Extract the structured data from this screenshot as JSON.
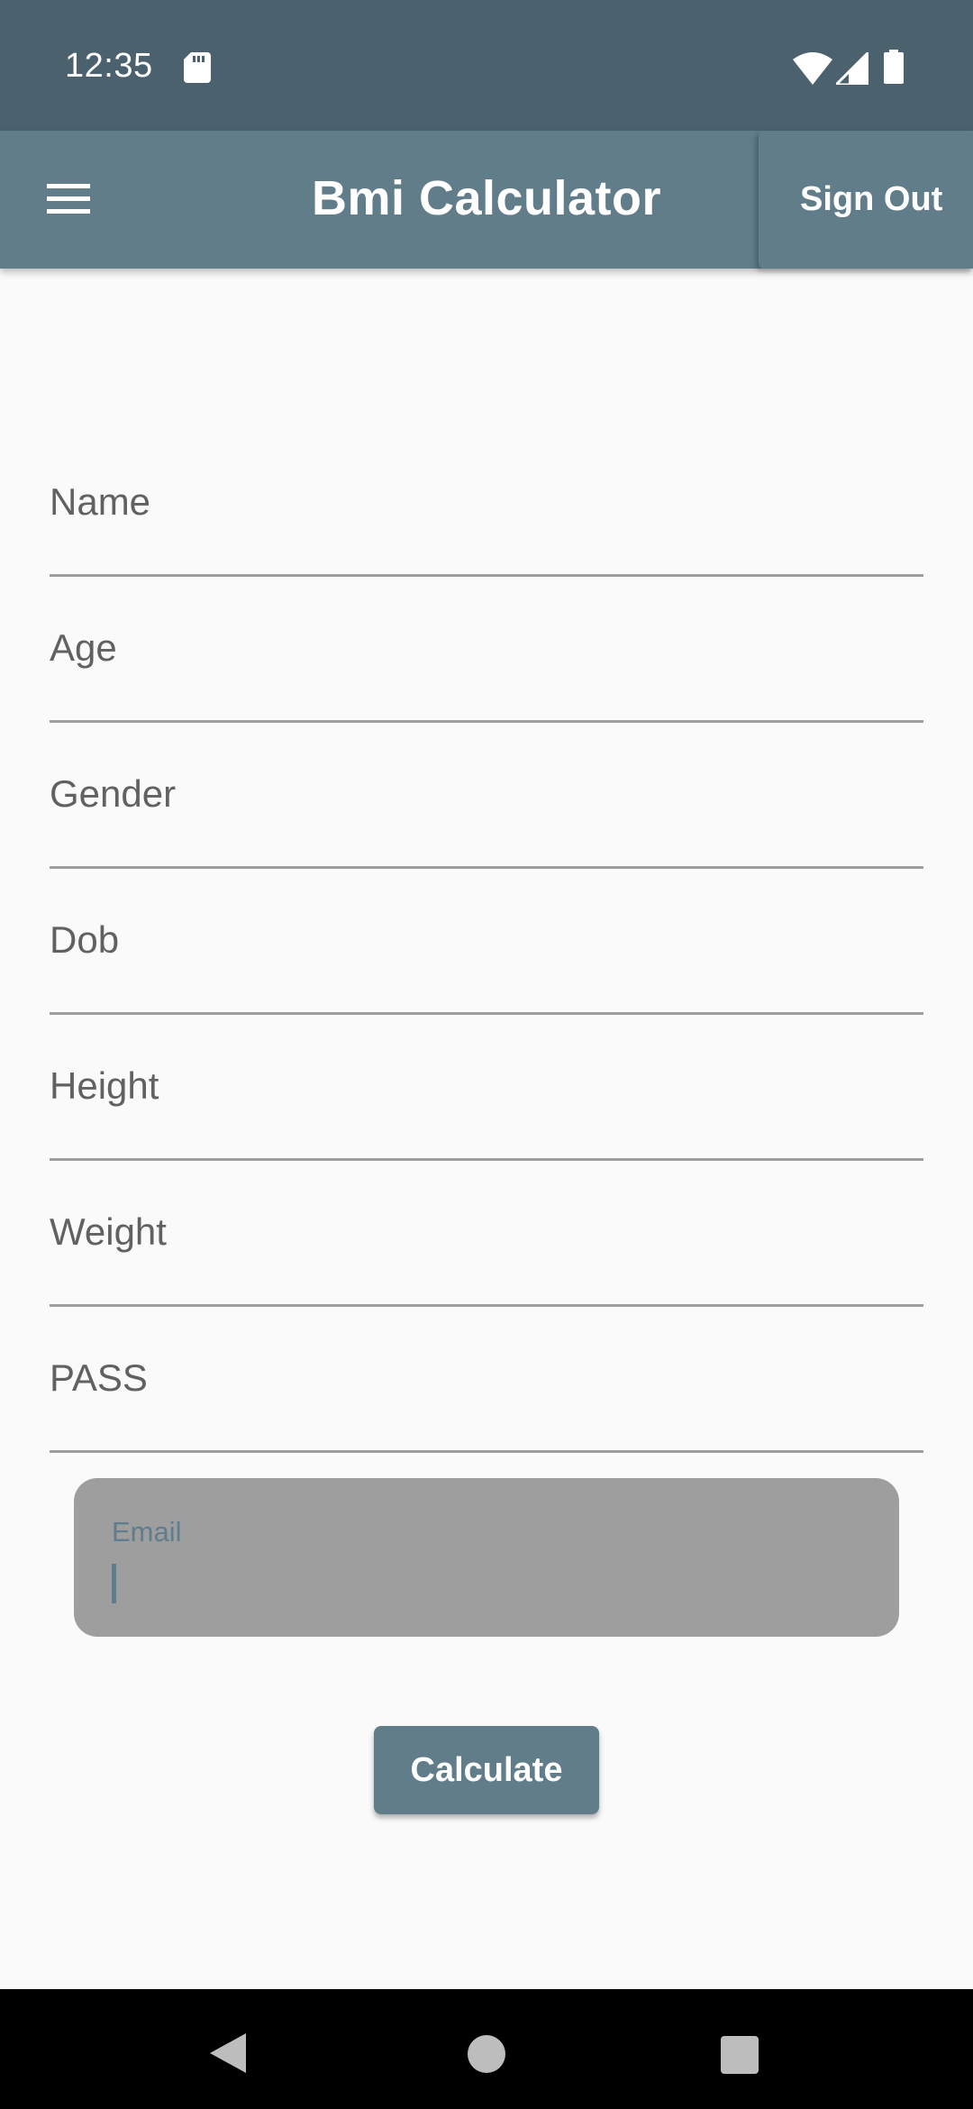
{
  "status_bar": {
    "time": "12:35",
    "icons": [
      "sd-card-icon",
      "wifi-icon",
      "signal-icon",
      "battery-icon"
    ]
  },
  "app_bar": {
    "title": "Bmi Calculator",
    "sign_out_label": "Sign Out",
    "menu_icon": "hamburger-menu-icon"
  },
  "form": {
    "fields": [
      {
        "label": "Name"
      },
      {
        "label": "Age"
      },
      {
        "label": "Gender"
      },
      {
        "label": "Dob"
      },
      {
        "label": "Height"
      },
      {
        "label": "Weight"
      },
      {
        "label": "PASS"
      }
    ],
    "email": {
      "label": "Email",
      "value": ""
    },
    "calculate_label": "Calculate"
  },
  "nav_bar": {
    "icons": [
      "back-icon",
      "home-icon",
      "recents-icon"
    ]
  },
  "colors": {
    "status_bar": "#4b626e",
    "app_bar": "#617d8a",
    "background": "#fafafa",
    "email_fill": "#9e9e9e",
    "accent": "#5f7d8c"
  }
}
